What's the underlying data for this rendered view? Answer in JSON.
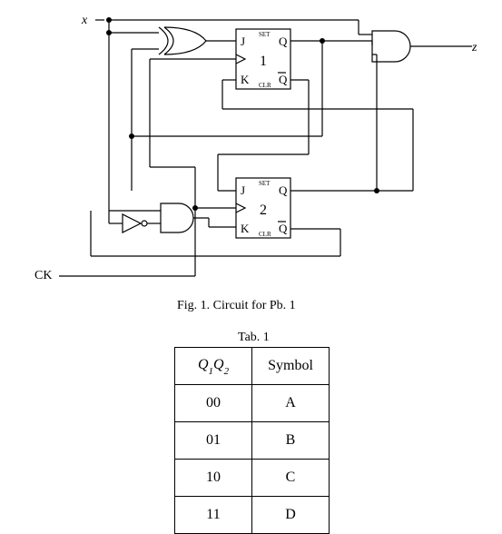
{
  "labels": {
    "x": "x",
    "z": "z",
    "ck": "CK"
  },
  "ff1": {
    "id": "1",
    "j": "J",
    "k": "K",
    "q": "Q",
    "qbar": "Q",
    "set": "SET",
    "clr": "CLR"
  },
  "ff2": {
    "id": "2",
    "j": "J",
    "k": "K",
    "q": "Q",
    "qbar": "Q",
    "set": "SET",
    "clr": "CLR"
  },
  "fig_caption": "Fig. 1. Circuit for Pb. 1",
  "table_caption": "Tab. 1",
  "table": {
    "header_state": "Q",
    "header_state_sub1": "1",
    "header_state_sub2": "2",
    "header_symbol": "Symbol",
    "rows": [
      {
        "state": "00",
        "symbol": "A"
      },
      {
        "state": "01",
        "symbol": "B"
      },
      {
        "state": "10",
        "symbol": "C"
      },
      {
        "state": "11",
        "symbol": "D"
      }
    ]
  }
}
